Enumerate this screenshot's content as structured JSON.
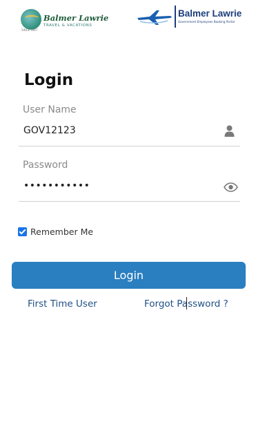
{
  "header": {
    "left_logo": {
      "brand": "Balmer Lawrie",
      "tagline": "TRAVEL & VACATIONS",
      "since": "SINCE 1867",
      "icon": "globe-logo-icon"
    },
    "right_logo": {
      "brand": "Balmer Lawrie",
      "tagline": "Government Employees Booking Portal",
      "icon": "airplane-logo-icon"
    }
  },
  "form": {
    "title": "Login",
    "username": {
      "label": "User Name",
      "value": "GOV12123",
      "icon": "user-icon"
    },
    "password": {
      "label": "Password",
      "value": "•••••••••••",
      "icon": "eye-icon"
    },
    "remember_me": {
      "label": "Remember Me",
      "checked": true
    },
    "submit_label": "Login",
    "first_time_user": "First Time User",
    "forgot_password": "Forgot Password ?"
  },
  "colors": {
    "primary_button": "#2a7fc0",
    "link": "#1f4f86",
    "checkbox": "#1a73e8"
  }
}
